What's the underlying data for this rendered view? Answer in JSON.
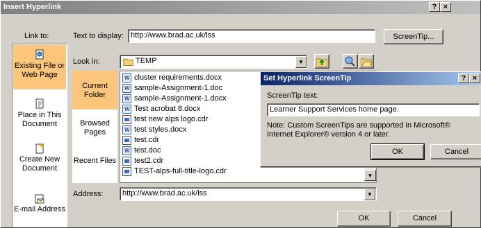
{
  "dialog": {
    "title": "Insert Hyperlink",
    "help_btn": "?",
    "close_btn": "×",
    "link_to_label": "Link to:",
    "text_to_display_label": "Text to display:",
    "text_to_display_value": "http://www.brad.ac.uk/lss",
    "screentip_btn": "ScreenTip...",
    "look_in_label": "Look in:",
    "look_in_value": "TEMP",
    "address_label": "Address:",
    "address_value": "http://www.brad.ac.uk/lss",
    "ok_btn": "OK",
    "cancel_btn": "Cancel"
  },
  "link_to_items": [
    {
      "label": "Existing File or Web Page",
      "icon": "existing-file-icon",
      "selected": true
    },
    {
      "label": "Place in This Document",
      "icon": "place-in-document-icon",
      "selected": false
    },
    {
      "label": "Create New Document",
      "icon": "create-document-icon",
      "selected": false
    },
    {
      "label": "E-mail Address",
      "icon": "email-icon",
      "selected": false
    }
  ],
  "nav_items": [
    {
      "label": "Current Folder",
      "selected": true
    },
    {
      "label": "Browsed Pages",
      "selected": false
    },
    {
      "label": "Recent Files",
      "selected": false
    }
  ],
  "files": [
    {
      "name": "cluster requirements.docx",
      "type": "word"
    },
    {
      "name": "sample-Assignment-1.doc",
      "type": "word"
    },
    {
      "name": "sample-Assignment-1.docx",
      "type": "word"
    },
    {
      "name": "Test acrobat 8.docx",
      "type": "word"
    },
    {
      "name": "test new alps logo.cdr",
      "type": "cdr"
    },
    {
      "name": "test styles.docx",
      "type": "word"
    },
    {
      "name": "test.cdr",
      "type": "cdr"
    },
    {
      "name": "test.doc",
      "type": "word"
    },
    {
      "name": "test2.cdr",
      "type": "cdr"
    },
    {
      "name": "TEST-alps-full-title-logo.cdr",
      "type": "cdr"
    }
  ],
  "screentip_dialog": {
    "title": "Set Hyperlink ScreenTip",
    "help_btn": "?",
    "close_btn": "×",
    "label": "ScreenTip text:",
    "value": "Learner Support Services home page.",
    "note": "Note: Custom ScreenTips are supported in Microsoft® Internet Explorer® version 4 or later.",
    "ok_btn": "OK",
    "cancel_btn": "Cancel"
  },
  "colors": {
    "selected": "#fcc57c",
    "title_active": "#0a246a"
  }
}
